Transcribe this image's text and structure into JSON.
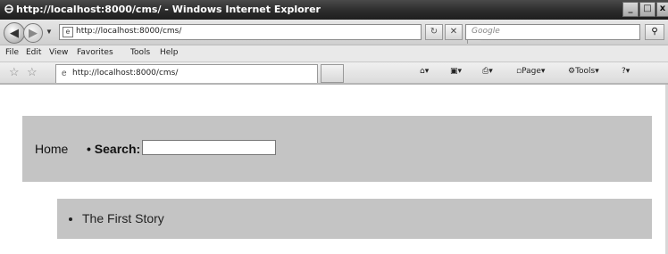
{
  "window": {
    "title": "http://localhost:8000/cms/ - Windows Internet Explorer",
    "buttons": [
      "_",
      "□",
      "x"
    ]
  },
  "address_bar": {
    "url": "http://localhost:8000/cms/",
    "search_placeholder": "Google"
  },
  "menu": [
    "File",
    "Edit",
    "View",
    "Favorites",
    "Tools",
    "Help"
  ],
  "tab": {
    "title": "http://localhost:8000/cms/"
  },
  "command_bar": {
    "page": "Page",
    "tools": "Tools"
  },
  "page": {
    "nav": {
      "home": "Home",
      "separator": " • ",
      "search_label": "Search:"
    },
    "stories": [
      {
        "title": "The First Story"
      }
    ]
  }
}
